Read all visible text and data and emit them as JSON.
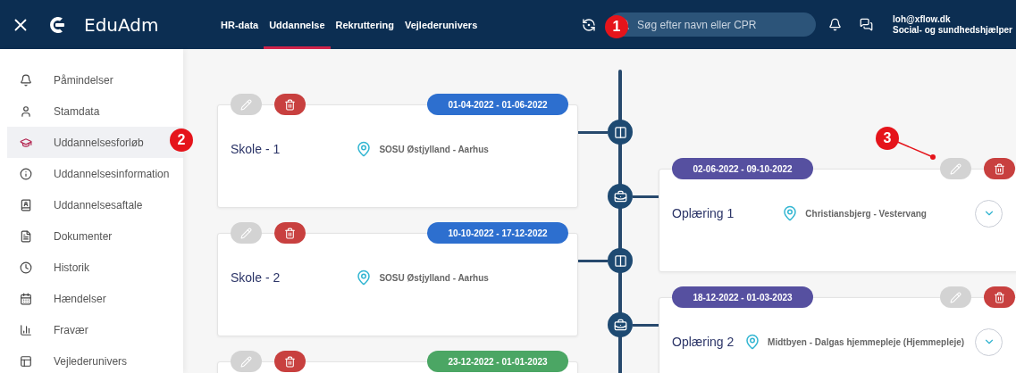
{
  "header": {
    "brand": "EduAdm",
    "tabs": [
      {
        "label": "HR-data",
        "selected": false
      },
      {
        "label": "Uddannelse",
        "selected": true
      },
      {
        "label": "Rekruttering",
        "selected": false
      },
      {
        "label": "Vejlederunivers",
        "selected": false
      }
    ],
    "search": {
      "placeholder": "Søg efter navn eller CPR"
    },
    "user": {
      "email": "loh@xflow.dk",
      "role": "Social- og sundhedshjælper"
    }
  },
  "sidebar": {
    "items": [
      {
        "label": "Påmindelser",
        "selected": false
      },
      {
        "label": "Stamdata",
        "selected": false
      },
      {
        "label": "Uddannelsesforløb",
        "selected": true
      },
      {
        "label": "Uddannelsesinformation",
        "selected": false
      },
      {
        "label": "Uddannelsesaftale",
        "selected": false
      },
      {
        "label": "Dokumenter",
        "selected": false
      },
      {
        "label": "Historik",
        "selected": false
      },
      {
        "label": "Hændelser",
        "selected": false
      },
      {
        "label": "Fravær",
        "selected": false
      },
      {
        "label": "Vejlederunivers",
        "selected": false
      }
    ]
  },
  "timeline": [
    {
      "kind": "school",
      "period": "01-04-2022 - 01-06-2022",
      "color": "#2d6fcf",
      "title": "Skole - 1",
      "location": "SOSU Østjylland - Aarhus"
    },
    {
      "kind": "training",
      "period": "02-06-2022 - 09-10-2022",
      "color": "#5650a0",
      "title": "Oplæring 1",
      "location": "Christiansbjerg - Vestervang"
    },
    {
      "kind": "school",
      "period": "10-10-2022 - 17-12-2022",
      "color": "#2d6fcf",
      "title": "Skole - 2",
      "location": "SOSU Østjylland - Aarhus"
    },
    {
      "kind": "training",
      "period": "18-12-2022 - 01-03-2023",
      "color": "#5650a0",
      "title": "Oplæring 2",
      "location": "Midtbyen - Dalgas hjemmepleje (Hjemmepleje)"
    },
    {
      "kind": "school",
      "period": "23-12-2022 - 01-01-2023",
      "color": "#4ba664"
    }
  ],
  "callouts": [
    {
      "label": "1"
    },
    {
      "label": "2"
    },
    {
      "label": "3"
    }
  ]
}
